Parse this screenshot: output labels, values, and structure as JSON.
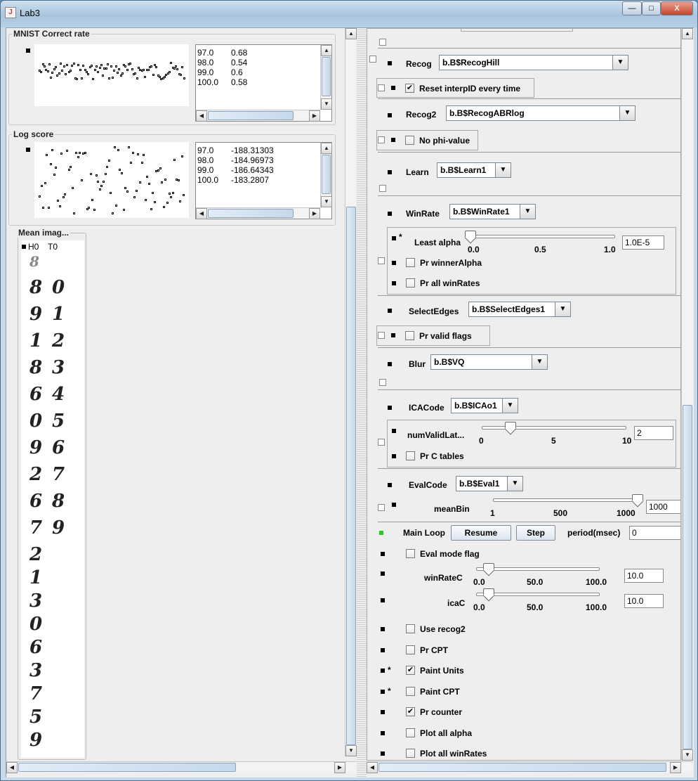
{
  "window": {
    "title": "Lab3",
    "buttons": {
      "minimize": "—",
      "maximize": "□",
      "close": "X"
    }
  },
  "left": {
    "mnist": {
      "title": "MNIST Correct rate",
      "rows": [
        [
          "97.0",
          "0.68"
        ],
        [
          "98.0",
          "0.54"
        ],
        [
          "99.0",
          "0.6"
        ],
        [
          "100.0",
          "0.58"
        ]
      ]
    },
    "logscore": {
      "title": "Log score",
      "rows": [
        [
          "97.0",
          "-188.31303"
        ],
        [
          "98.0",
          "-184.96973"
        ],
        [
          "99.0",
          "-186.64343"
        ],
        [
          "100.0",
          "-183.2807"
        ]
      ]
    },
    "meanimage": {
      "title": "Mean imag...",
      "col_h": "H0",
      "col_t": "T0",
      "pairs": [
        [
          "8",
          "0"
        ],
        [
          "9",
          "1"
        ],
        [
          "1",
          "2"
        ],
        [
          "8",
          "3"
        ],
        [
          "6",
          "4"
        ],
        [
          "0",
          "5"
        ],
        [
          "9",
          "6"
        ],
        [
          "2",
          "7"
        ],
        [
          "6",
          "8"
        ],
        [
          "7",
          "9"
        ]
      ],
      "singles": [
        "2",
        "1",
        "3",
        "0",
        "6",
        "3",
        "7",
        "5",
        "9"
      ],
      "first": "8"
    }
  },
  "right": {
    "recog": {
      "label": "Recog",
      "value": "b.B$RecogHill",
      "reset_label": "Reset interpID every time"
    },
    "recog2": {
      "label": "Recog2",
      "value": "b.B$RecogABRlog",
      "phi_label": "No phi-value"
    },
    "learn": {
      "label": "Learn",
      "value": "b.B$Learn1"
    },
    "winrate": {
      "label": "WinRate",
      "value": "b.B$WinRate1",
      "slider_label": "Least alpha",
      "ticks": [
        "0.0",
        "0.5",
        "1.0"
      ],
      "field": "1.0E-5",
      "star": "*",
      "level": 0.0,
      "pr_winner": "Pr winnerAlpha",
      "pr_all": "Pr all winRates"
    },
    "selectedges": {
      "label": "SelectEdges",
      "value": "b.B$SelectEdges1",
      "pr_valid": "Pr valid flags"
    },
    "blur": {
      "label": "Blur",
      "value": "b.B$VQ"
    },
    "icacode": {
      "label": "ICACode",
      "value": "b.B$ICAo1",
      "slider_label": "numValidLat...",
      "ticks": [
        "0",
        "5",
        "10"
      ],
      "field": "2",
      "level": 0.2,
      "prc": "Pr C tables"
    },
    "evalcode": {
      "label": "EvalCode",
      "value": "b.B$Eval1",
      "slider_label": "meanBin",
      "ticks": [
        "1",
        "500",
        "1000"
      ],
      "field": "1000",
      "level": 1.0
    },
    "mainloop": {
      "label": "Main Loop",
      "resume": "Resume",
      "step": "Step",
      "period_label": "period(msec)",
      "period": "0"
    },
    "options": {
      "eval_mode": "Eval mode flag",
      "winratec": {
        "label": "winRateC",
        "ticks": [
          "0.0",
          "50.0",
          "100.0"
        ],
        "field": "10.0",
        "level": 0.1
      },
      "icac": {
        "label": "icaC",
        "ticks": [
          "0.0",
          "50.0",
          "100.0"
        ],
        "field": "10.0",
        "level": 0.1
      },
      "checks": [
        {
          "label": "Use recog2",
          "checked": false,
          "star": ""
        },
        {
          "label": "Pr CPT",
          "checked": false,
          "star": ""
        },
        {
          "label": "Paint Units",
          "checked": true,
          "star": "*"
        },
        {
          "label": "Paint CPT",
          "checked": false,
          "star": "*"
        },
        {
          "label": "Pr counter",
          "checked": true,
          "star": ""
        },
        {
          "label": "Plot all alpha",
          "checked": false,
          "star": ""
        },
        {
          "label": "Plot all winRates",
          "checked": false,
          "star": ""
        }
      ]
    }
  },
  "colors": {
    "status_green": "#22cc22",
    "accent": "#8aa5c0"
  }
}
